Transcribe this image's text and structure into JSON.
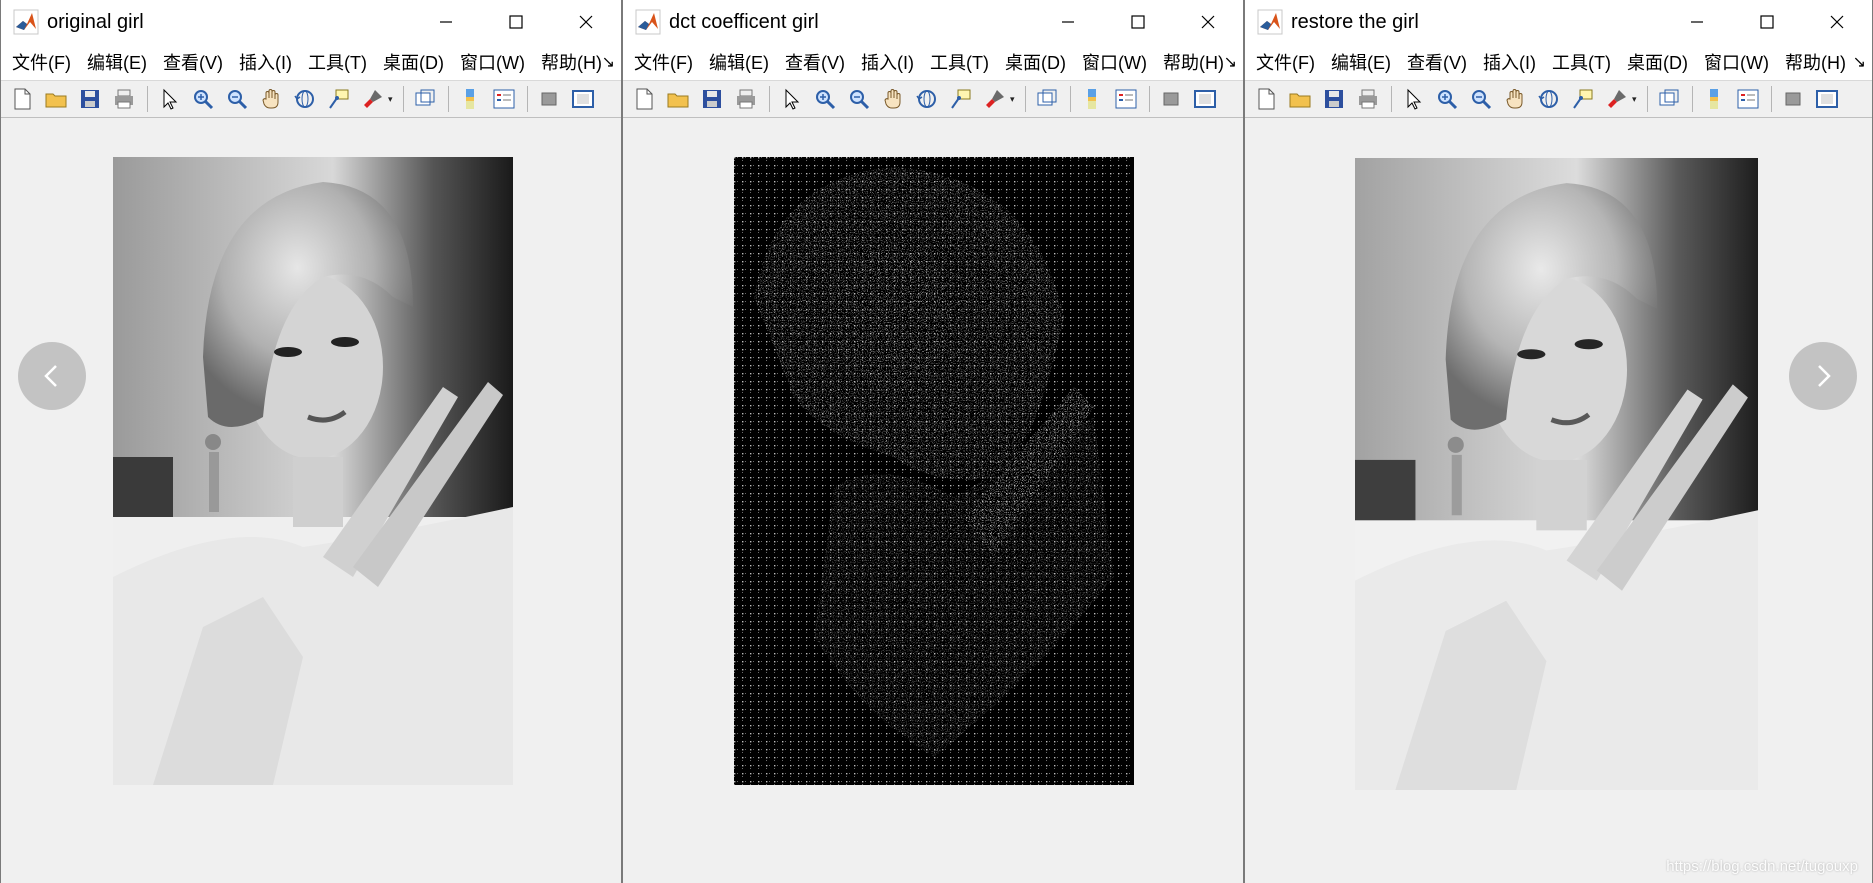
{
  "windows": [
    {
      "title": "original girl"
    },
    {
      "title": "dct coefficent girl"
    },
    {
      "title": "restore the girl"
    }
  ],
  "menu": [
    "文件(F)",
    "编辑(E)",
    "查看(V)",
    "插入(I)",
    "工具(T)",
    "桌面(D)",
    "窗口(W)",
    "帮助(H)"
  ],
  "menu_overflow": "↘",
  "toolbar_icons": [
    "new-file-icon",
    "open-folder-icon",
    "save-icon",
    "print-icon",
    "pointer-icon",
    "zoom-in-icon",
    "zoom-out-icon",
    "pan-hand-icon",
    "rotate-3d-icon",
    "data-cursor-icon",
    "brush-icon",
    "link-plot-icon",
    "colorbar-icon",
    "legend-icon",
    "hide-plot-tools-icon",
    "show-plot-tools-icon"
  ],
  "nav": {
    "prev": "chevron-left-icon",
    "next": "chevron-right-icon"
  },
  "watermark": "https://blog.csdn.net/tugouxp",
  "colors": {
    "accent": "#f0f0f0",
    "dct_background": "#000000"
  }
}
